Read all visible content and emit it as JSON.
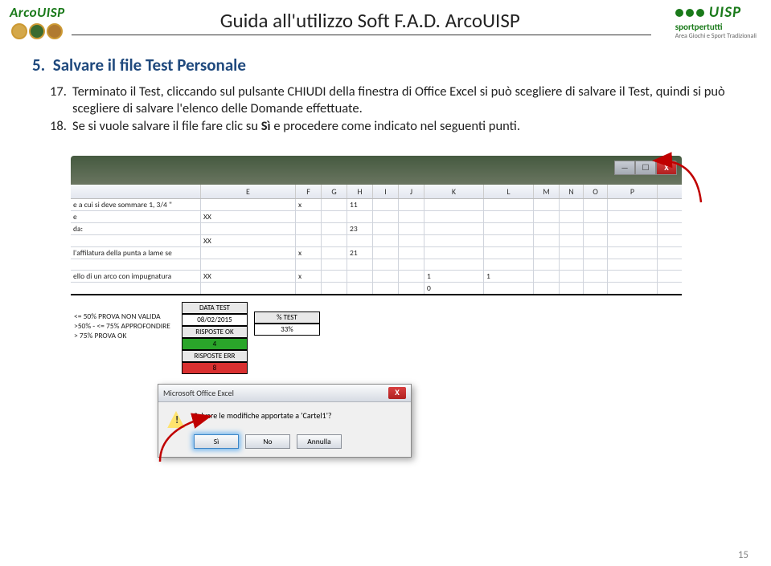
{
  "header": {
    "logo_left": "ArcoUISP",
    "title": "Guida all'utilizzo Soft F.A.D. ArcoUISP",
    "logo_right": {
      "main": "UISP",
      "sub1": "sportpertutti",
      "sub2": "Area Giochi e Sport Tradizionali"
    }
  },
  "section": {
    "num": "5.",
    "title": "Salvare il file Test Personale"
  },
  "items": [
    {
      "num": "17.",
      "text": "Terminato il Test, cliccando sul pulsante CHIUDI della finestra di Office Excel si può scegliere di salvare il Test, quindi si può scegliere di salvare l'elenco delle Domande effettuate."
    },
    {
      "num": "18.",
      "text_pre": "Se si vuole salvare il file fare clic su ",
      "bold": "Sì",
      "text_post": " e procedere come indicato nel seguenti punti."
    }
  ],
  "excel": {
    "cols": [
      "E",
      "F",
      "G",
      "H",
      "I",
      "J",
      "K",
      "L",
      "M",
      "N",
      "O",
      "P"
    ],
    "rows": [
      {
        "lead": "e a cui si deve sommare 1, 3/4 \"",
        "E": "",
        "F": "x",
        "G": "",
        "H": "11"
      },
      {
        "lead": "e",
        "E": "XX"
      },
      {
        "lead": "da:",
        "E": "",
        "F": "",
        "G": "",
        "H": "23"
      },
      {
        "lead": "",
        "E": "XX"
      },
      {
        "lead": "l'affilatura della punta a lame se",
        "E": "",
        "F": "x",
        "G": "",
        "H": "21"
      },
      {
        "lead": "",
        "E": ""
      },
      {
        "lead": "ello di un arco con impugnatura",
        "E": "XX",
        "F": "x",
        "G": "",
        "H": "",
        "I": "",
        "J": "",
        "K": "1",
        "L": "1"
      },
      {
        "lead": "",
        "E": "",
        "K": "0"
      }
    ],
    "summary_left": [
      {
        "t": "DATA TEST",
        "cls": "sb-grey"
      },
      {
        "t": "08/02/2015",
        "cls": ""
      },
      {
        "t": "RISPOSTE OK",
        "cls": "sb-grey"
      },
      {
        "t": "4",
        "cls": "sb-green"
      },
      {
        "t": "RISPOSTE ERR",
        "cls": "sb-grey"
      },
      {
        "t": "8",
        "cls": "sb-red"
      }
    ],
    "notes": [
      "<= 50% PROVA NON VALIDA",
      ">50% - <= 75% APPROFONDIRE",
      "> 75% PROVA OK"
    ],
    "summary_right": [
      {
        "t": "% TEST",
        "cls": "sb-grey"
      },
      {
        "t": "33%",
        "cls": ""
      }
    ]
  },
  "dialog": {
    "title": "Microsoft Office Excel",
    "msg": "Salvare le modifiche apportate a 'Cartel1'?",
    "btn_yes": "Sì",
    "btn_no": "No",
    "btn_cancel": "Annulla"
  },
  "page_num": "15"
}
